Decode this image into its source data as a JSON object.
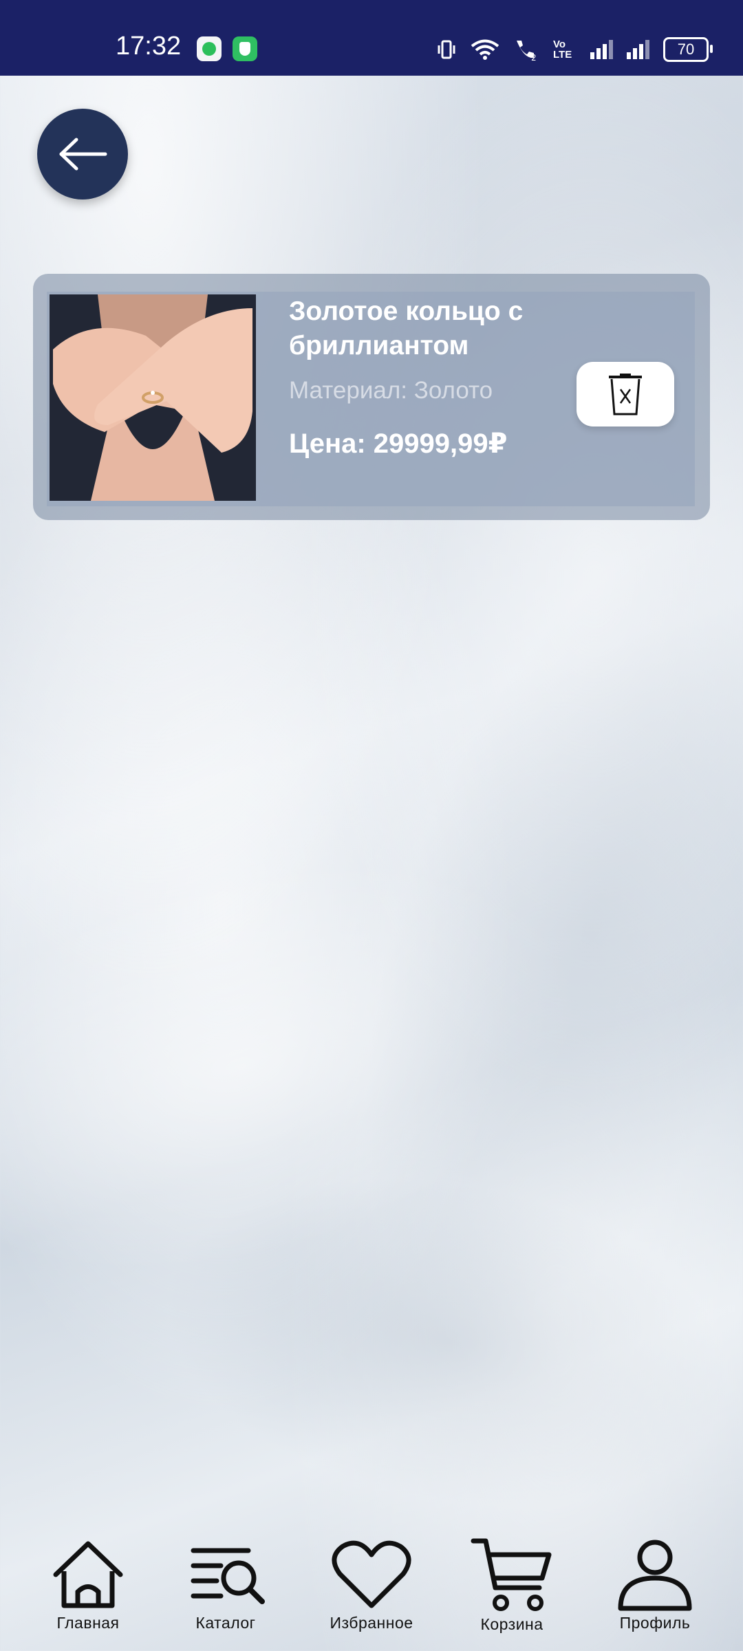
{
  "status_bar": {
    "time": "17:32",
    "battery": "70",
    "network": "Vo LTE"
  },
  "cart": {
    "items": [
      {
        "name": "Золотое кольцо с бриллиантом",
        "material": "Материал: Золото",
        "price": "Цена: 29999,99₽"
      }
    ]
  },
  "nav": {
    "home": "Главная",
    "catalog": "Каталог",
    "favorites": "Избранное",
    "cart": "Корзина",
    "profile": "Профиль"
  },
  "colors": {
    "status_bar": "#1b2166",
    "back_button": "#233359",
    "card_bg": "#96a5bc"
  }
}
